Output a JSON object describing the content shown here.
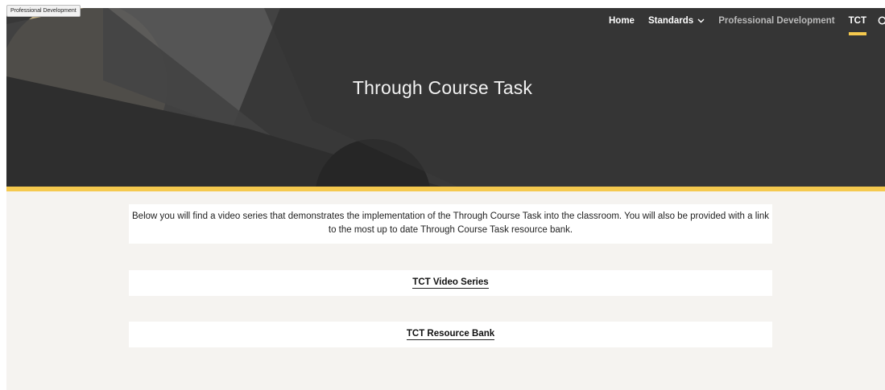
{
  "site_badge": "Professional Development",
  "nav": {
    "home": "Home",
    "standards": "Standards",
    "professional_development": "Professional Development",
    "tct": "TCT",
    "active": "TCT",
    "icons": {
      "dropdown": "chevron-down-icon",
      "search": "search-icon"
    }
  },
  "hero": {
    "title": "Through Course Task"
  },
  "intro": {
    "text": "Below you will find a video series that demonstrates the implementation of the Through Course Task into the classroom. You will also be provided with a link to the most up to date Through Course Task resource bank."
  },
  "links": {
    "video_series": "TCT Video Series",
    "resource_bank": "TCT Resource Bank"
  },
  "colors": {
    "accent": "#f5c94e",
    "hero_bg": "#3a3a3a",
    "content_bg": "#f5f3f0"
  }
}
